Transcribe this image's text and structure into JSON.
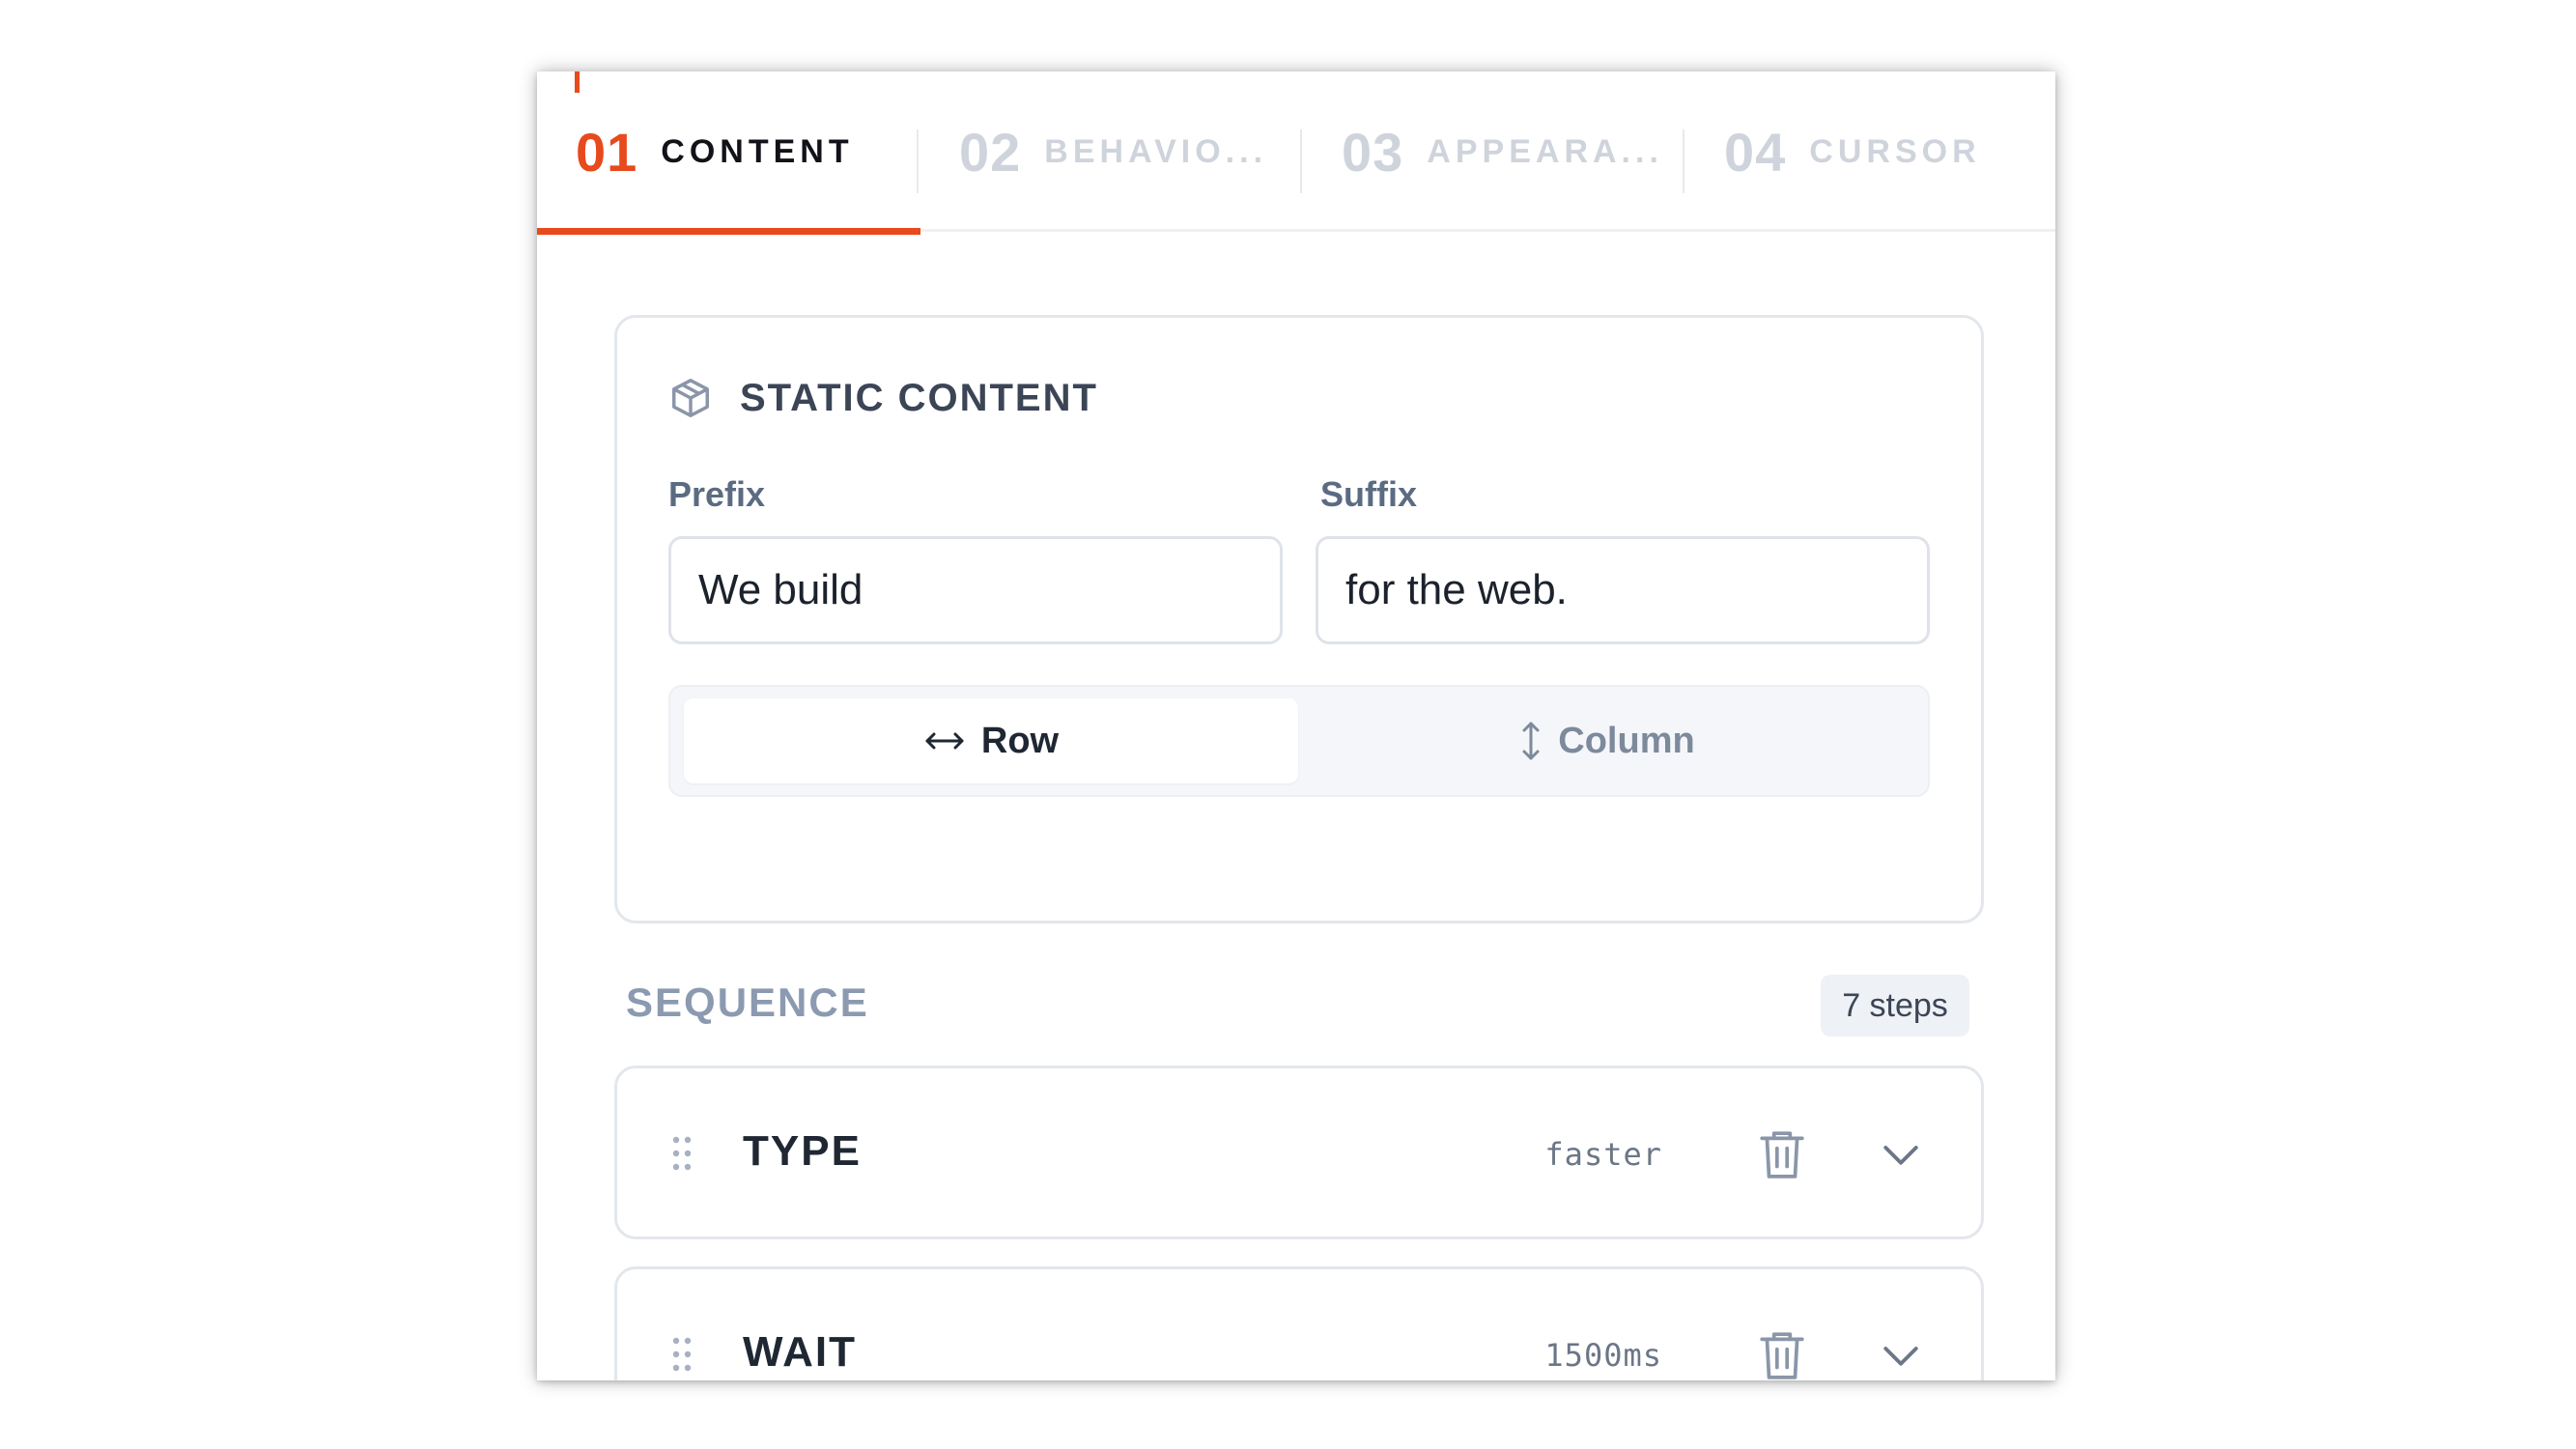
{
  "tabs": [
    {
      "num": "01",
      "label": "CONTENT",
      "active": true
    },
    {
      "num": "02",
      "label": "BEHAVIO..."
    },
    {
      "num": "03",
      "label": "APPEARA..."
    },
    {
      "num": "04",
      "label": "CURSOR"
    }
  ],
  "static_content": {
    "title": "STATIC CONTENT",
    "icon": "cube-icon",
    "prefix_label": "Prefix",
    "prefix_value": "We build",
    "suffix_label": "Suffix",
    "suffix_value": "for the web.",
    "layout_options": [
      {
        "label": "Row",
        "icon": "arrow-left-right-icon",
        "selected": true
      },
      {
        "label": "Column",
        "icon": "arrow-up-down-icon",
        "selected": false
      }
    ]
  },
  "sequence": {
    "title": "SEQUENCE",
    "count_label": "7 steps",
    "steps": [
      {
        "name": "TYPE",
        "value": "faster"
      },
      {
        "name": "WAIT",
        "value": "1500ms"
      }
    ]
  },
  "colors": {
    "accent": "#e8491d",
    "inactive_tab": "#cfd4dc",
    "muted_text": "#8b9ab0"
  }
}
